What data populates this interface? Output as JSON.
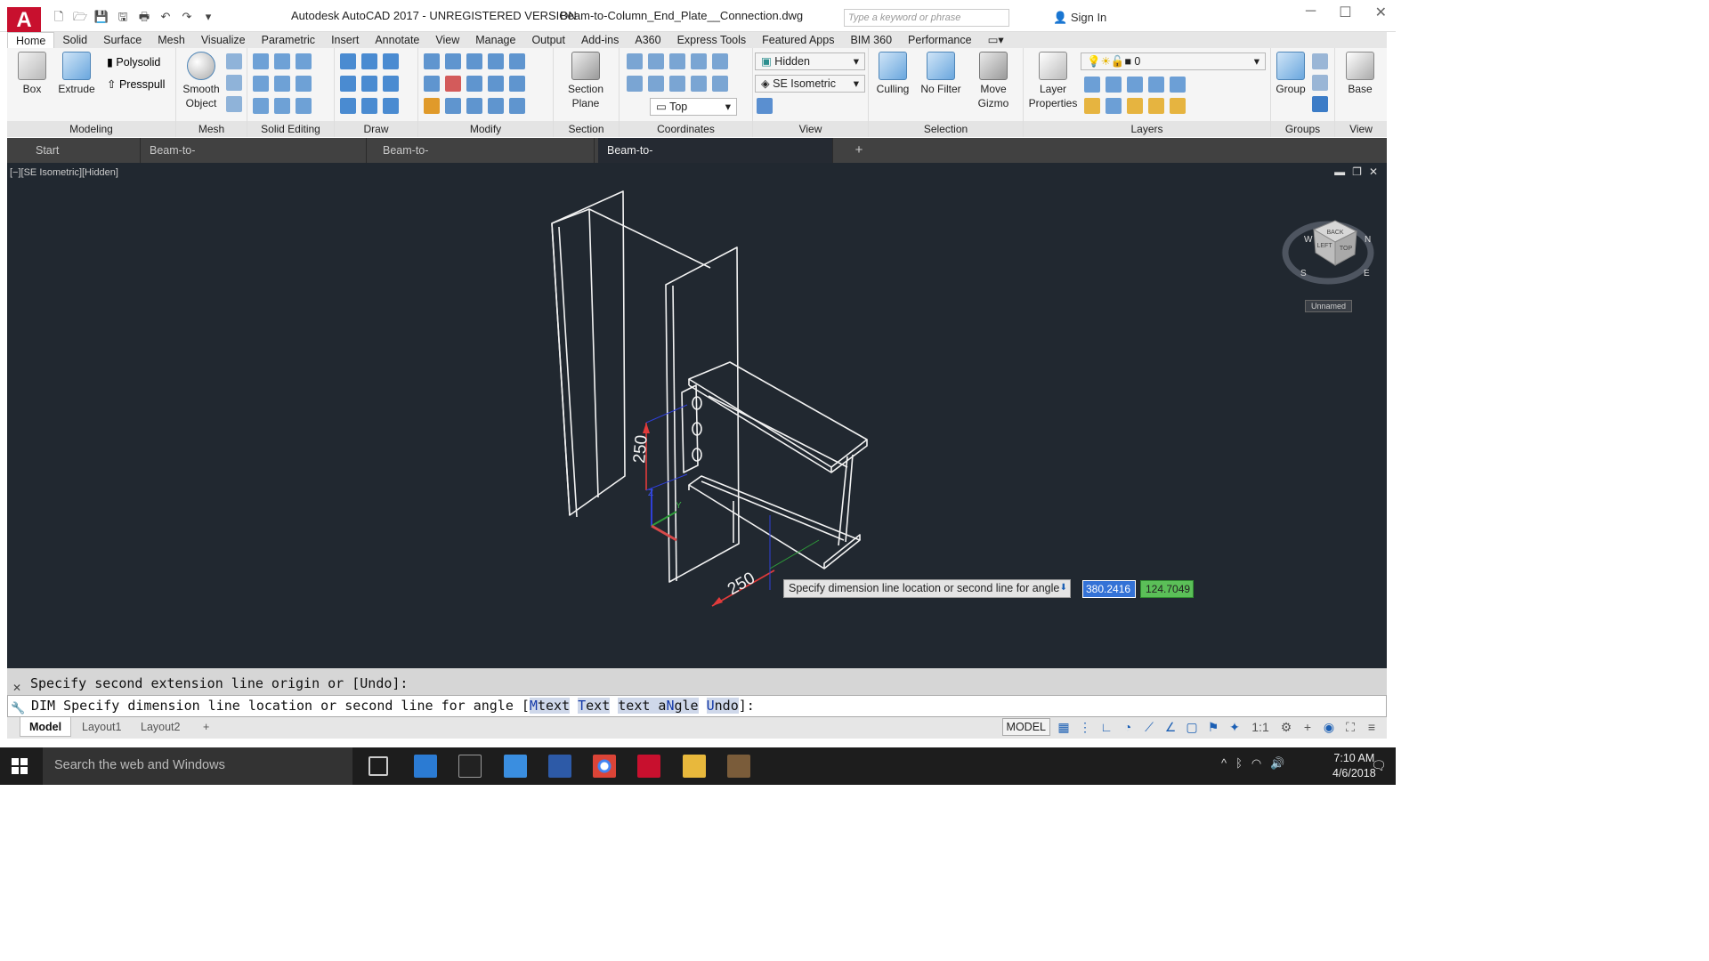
{
  "title_bar": {
    "app_title": "Autodesk AutoCAD 2017 - UNREGISTERED VERSION",
    "doc_title": "Beam-to-Column_End_Plate__Connection.dwg",
    "search_placeholder": "Type a keyword or phrase",
    "sign_in": "Sign In",
    "app_logo": "A"
  },
  "menu_tabs": [
    "Home",
    "Solid",
    "Surface",
    "Mesh",
    "Visualize",
    "Parametric",
    "Insert",
    "Annotate",
    "View",
    "Manage",
    "Output",
    "Add-ins",
    "A360",
    "Express Tools",
    "Featured Apps",
    "BIM 360",
    "Performance"
  ],
  "ribbon": {
    "modeling": {
      "label": "Modeling",
      "box": "Box",
      "extrude": "Extrude",
      "polysolid": "Polysolid",
      "presspull": "Presspull"
    },
    "mesh": {
      "label": "Mesh",
      "smooth_object": "Smooth Object"
    },
    "solid_editing": {
      "label": "Solid Editing"
    },
    "draw": {
      "label": "Draw"
    },
    "modify": {
      "label": "Modify"
    },
    "section": {
      "label": "Section",
      "section_plane": "Section Plane"
    },
    "coordinates": {
      "label": "Coordinates"
    },
    "view": {
      "label": "View",
      "visual_style": "Hidden",
      "view_preset": "SE Isometric",
      "ucs": "Top"
    },
    "selection": {
      "label": "Selection",
      "culling": "Culling",
      "no_filter": "No Filter",
      "move_gizmo": "Move Gizmo"
    },
    "layers": {
      "label": "Layers",
      "layer_properties": "Layer Properties",
      "current_layer": "0"
    },
    "groups": {
      "label": "Groups",
      "group": "Group"
    },
    "view2": {
      "label": "View",
      "base": "Base"
    }
  },
  "doc_tabs": {
    "start": "Start",
    "items": [
      "Beam-to-Column_End_Plate_Connection*",
      "Beam-to-Beam_End_Plate_Connection*",
      "Beam-to-Column_End_Plate__Connection*"
    ]
  },
  "viewport": {
    "label": "[−][SE Isometric][Hidden]",
    "dim_vertical": "250",
    "dim_horizontal": "250",
    "viewcube_top": "TOP",
    "viewcube_left": "LEFT",
    "viewcube_back": "BACK",
    "compass_s": "S",
    "compass_e": "E",
    "compass_n": "N",
    "compass_w": "W",
    "ucs_y": "Y",
    "ucs_z": "Z",
    "unnamed": "Unnamed"
  },
  "dynamic_input": {
    "prompt": "Specify dimension line location or second line for angle",
    "value1": "380.2416",
    "value2": "124.7049"
  },
  "command": {
    "history": "Specify second extension line origin or [Undo]:",
    "prefix": "DIM",
    "prompt": "Specify dimension line location or second line for angle [",
    "opt1_key": "M",
    "opt1_rest": "text",
    "opt2_key": "T",
    "opt2_rest": "ext",
    "opt3_pre": "text a",
    "opt3_key": "N",
    "opt3_rest": "gle",
    "opt4_key": "U",
    "opt4_rest": "ndo",
    "suffix": "]:"
  },
  "layout_tabs": [
    "Model",
    "Layout1",
    "Layout2"
  ],
  "status": {
    "model": "MODEL",
    "scale": "1:1"
  },
  "taskbar": {
    "search": "Search the web and Windows",
    "time": "7:10 AM",
    "date": "4/6/2018"
  },
  "colors": {
    "viewport_bg": "#212830",
    "accent": "#c8102e",
    "dyn_blue": "#3472d6",
    "dyn_green": "#5bbf58"
  }
}
